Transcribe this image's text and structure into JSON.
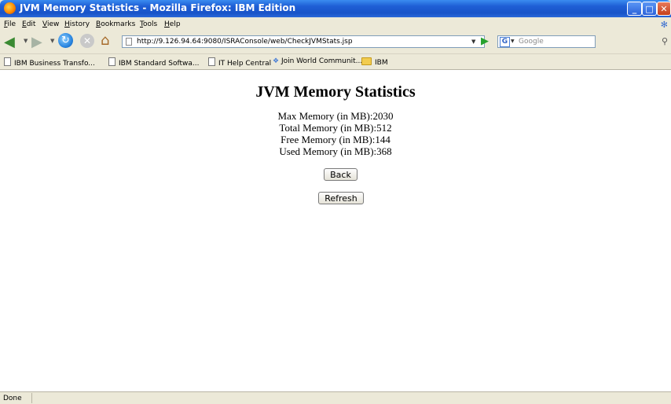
{
  "window": {
    "title": "JVM Memory Statistics - Mozilla Firefox: IBM Edition",
    "controls": {
      "minimize": "_",
      "maximize": "□",
      "close": "✕"
    }
  },
  "menu": [
    "File",
    "Edit",
    "View",
    "History",
    "Bookmarks",
    "Tools",
    "Help"
  ],
  "nav": {
    "url": "http://9.126.94.64:9080/ISRAConsole/web/CheckJVMStats.jsp",
    "search_placeholder": "Google"
  },
  "bookmarks": [
    "IBM Business Transfo...",
    "IBM Standard Softwa...",
    "IT Help Central",
    "Join World Communit...",
    "IBM"
  ],
  "page": {
    "title": "JVM Memory Statistics",
    "stats": [
      "Max Memory (in MB):2030",
      "Total Memory (in MB):512",
      "Free Memory (in MB):144",
      "Used Memory (in MB):368"
    ],
    "back_label": "Back",
    "refresh_label": "Refresh"
  },
  "status": "Done",
  "colors": {
    "titlebar": "#1f5fd6",
    "chrome": "#ece9d8",
    "content_bg": "#ffffff"
  }
}
